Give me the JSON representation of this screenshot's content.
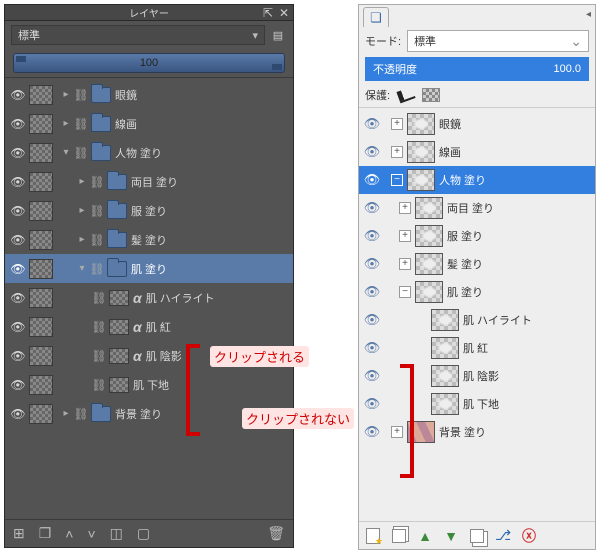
{
  "dark": {
    "title": "レイヤー",
    "mode": "標準",
    "opacity": "100",
    "layers": [
      {
        "name": "眼鏡",
        "type": "folder",
        "depth": 1,
        "eye": true,
        "lock": true,
        "expand": "+"
      },
      {
        "name": "線画",
        "type": "folder",
        "depth": 1,
        "eye": true,
        "lock": true,
        "expand": "+"
      },
      {
        "name": "人物 塗り",
        "type": "folder",
        "depth": 1,
        "eye": true,
        "lock": true,
        "expand": "-"
      },
      {
        "name": "両目 塗り",
        "type": "folder",
        "depth": 2,
        "eye": true,
        "lock": true,
        "expand": "+"
      },
      {
        "name": "服 塗り",
        "type": "folder",
        "depth": 2,
        "eye": true,
        "lock": true,
        "expand": "+"
      },
      {
        "name": "髪 塗り",
        "type": "folder",
        "depth": 2,
        "eye": true,
        "lock": true,
        "expand": "+"
      },
      {
        "name": "肌 塗り",
        "type": "folder",
        "depth": 2,
        "eye": true,
        "lock": true,
        "expand": "-",
        "selected": true
      },
      {
        "name": "肌 ハイライト",
        "type": "layer",
        "depth": 3,
        "eye": true,
        "lock": true,
        "alpha": true
      },
      {
        "name": "肌 紅",
        "type": "layer",
        "depth": 3,
        "eye": true,
        "lock": true,
        "alpha": true
      },
      {
        "name": "肌 陰影",
        "type": "layer",
        "depth": 3,
        "eye": true,
        "lock": true,
        "alpha": true
      },
      {
        "name": "肌 下地",
        "type": "layer",
        "depth": 3,
        "eye": true,
        "lock": true
      },
      {
        "name": "背景 塗り",
        "type": "folder",
        "depth": 1,
        "eye": true,
        "lock": true,
        "expand": "+"
      }
    ]
  },
  "light": {
    "mode_label": "モード:",
    "mode_value": "標準",
    "opacity_label": "不透明度",
    "opacity_value": "100.0",
    "protect_label": "保護:",
    "layers": [
      {
        "name": "眼鏡",
        "depth": 0,
        "expand": "+",
        "thumb": "blob"
      },
      {
        "name": "線画",
        "depth": 0,
        "expand": "+",
        "thumb": "blob"
      },
      {
        "name": "人物 塗り",
        "depth": 0,
        "expand": "−",
        "thumb": "blob",
        "selected": true
      },
      {
        "name": "両目 塗り",
        "depth": 1,
        "expand": "+",
        "thumb": "blob"
      },
      {
        "name": "服 塗り",
        "depth": 1,
        "expand": "+",
        "thumb": "blob"
      },
      {
        "name": "髪 塗り",
        "depth": 1,
        "expand": "+",
        "thumb": "blob"
      },
      {
        "name": "肌 塗り",
        "depth": 1,
        "expand": "−",
        "thumb": "blob"
      },
      {
        "name": "肌 ハイライト",
        "depth": 2,
        "thumb": "blob"
      },
      {
        "name": "肌 紅",
        "depth": 2,
        "thumb": "blob"
      },
      {
        "name": "肌 陰影",
        "depth": 2,
        "thumb": "blob"
      },
      {
        "name": "肌 下地",
        "depth": 2,
        "thumb": "blob"
      },
      {
        "name": "背景 塗り",
        "depth": 0,
        "expand": "+",
        "thumb": "floor"
      }
    ]
  },
  "annotations": {
    "clipped": "クリップされる",
    "not_clipped": "クリップされない"
  }
}
